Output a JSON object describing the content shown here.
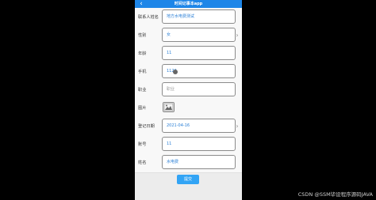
{
  "header": {
    "title": "时间记事本app",
    "back_icon": "chevron-left-icon"
  },
  "form": {
    "contact_name": {
      "label": "联系人姓名",
      "value": "地方水电费测试"
    },
    "gender": {
      "label": "性别",
      "value": "女"
    },
    "age": {
      "label": "年龄",
      "value": "11"
    },
    "phone": {
      "label": "手机",
      "value": "1122"
    },
    "occupation": {
      "label": "职业",
      "placeholder": "职业"
    },
    "image": {
      "label": "图片",
      "icon": "image-upload-icon"
    },
    "register_date": {
      "label": "登记日期",
      "value": "2021-04-16"
    },
    "account": {
      "label": "账号",
      "value": "11"
    },
    "name": {
      "label": "姓名",
      "value": "水电费"
    }
  },
  "submit_label": "提交",
  "watermark": "CSDN @SSM毕设程序源码JAVA"
}
